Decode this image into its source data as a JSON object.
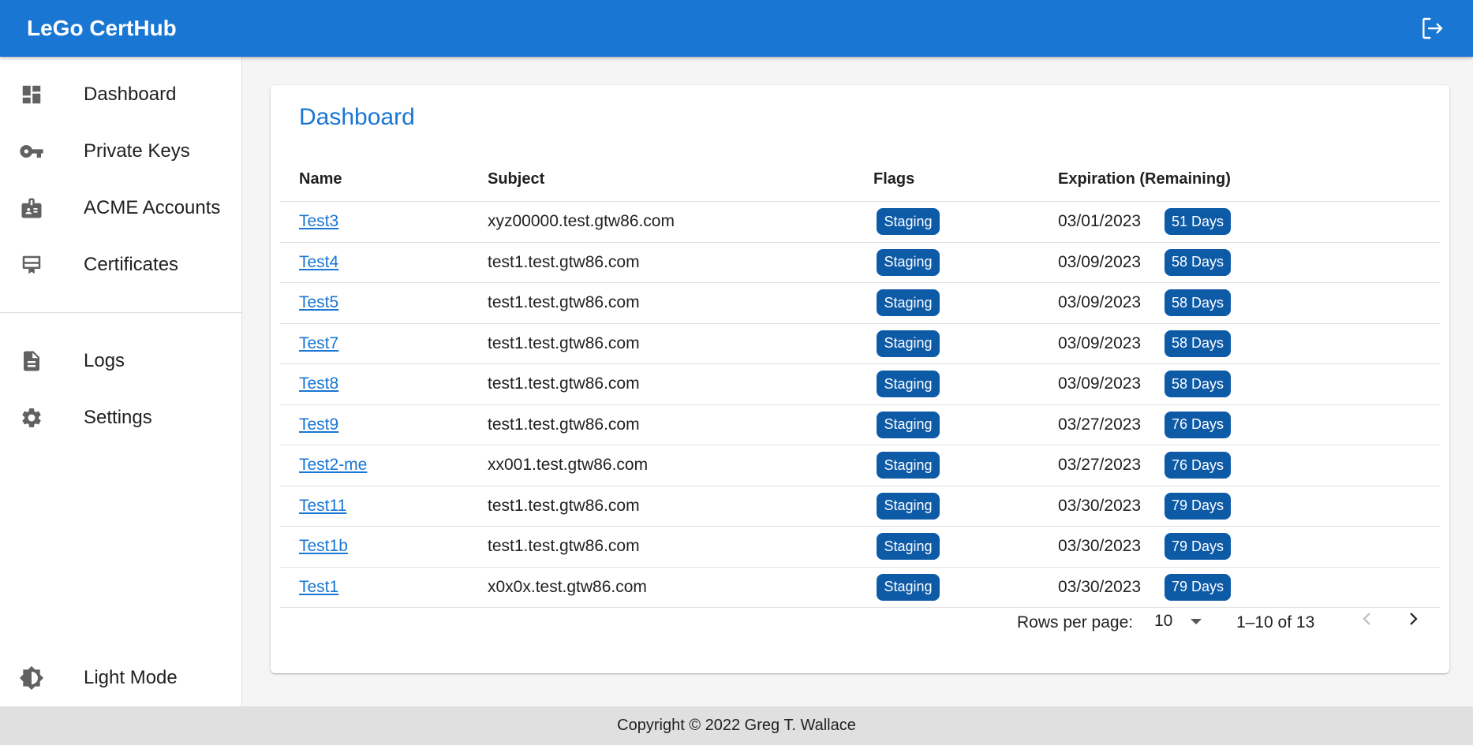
{
  "app": {
    "title": "LeGo CertHub",
    "logout_icon": "logout-icon",
    "accent": "#1976d2"
  },
  "sidebar": {
    "items": [
      {
        "label": "Dashboard",
        "icon": "dashboard-icon"
      },
      {
        "label": "Private Keys",
        "icon": "key-icon"
      },
      {
        "label": "ACME Accounts",
        "icon": "badge-icon"
      },
      {
        "label": "Certificates",
        "icon": "certificate-icon"
      },
      {
        "label": "Logs",
        "icon": "document-icon"
      },
      {
        "label": "Settings",
        "icon": "gear-icon"
      }
    ],
    "mode_toggle": {
      "label": "Light Mode",
      "icon": "brightness-icon"
    }
  },
  "main": {
    "title": "Dashboard",
    "columns": [
      "Name",
      "Subject",
      "Flags",
      "Expiration (Remaining)"
    ],
    "rows": [
      {
        "name": "Test3",
        "subject": "xyz00000.test.gtw86.com",
        "flag": "Staging",
        "expiration": "03/01/2023",
        "remaining": "51 Days"
      },
      {
        "name": "Test4",
        "subject": "test1.test.gtw86.com",
        "flag": "Staging",
        "expiration": "03/09/2023",
        "remaining": "58 Days"
      },
      {
        "name": "Test5",
        "subject": "test1.test.gtw86.com",
        "flag": "Staging",
        "expiration": "03/09/2023",
        "remaining": "58 Days"
      },
      {
        "name": "Test7",
        "subject": "test1.test.gtw86.com",
        "flag": "Staging",
        "expiration": "03/09/2023",
        "remaining": "58 Days"
      },
      {
        "name": "Test8",
        "subject": "test1.test.gtw86.com",
        "flag": "Staging",
        "expiration": "03/09/2023",
        "remaining": "58 Days"
      },
      {
        "name": "Test9",
        "subject": "test1.test.gtw86.com",
        "flag": "Staging",
        "expiration": "03/27/2023",
        "remaining": "76 Days"
      },
      {
        "name": "Test2-me",
        "subject": "xx001.test.gtw86.com",
        "flag": "Staging",
        "expiration": "03/27/2023",
        "remaining": "76 Days"
      },
      {
        "name": "Test11",
        "subject": "test1.test.gtw86.com",
        "flag": "Staging",
        "expiration": "03/30/2023",
        "remaining": "79 Days"
      },
      {
        "name": "Test1b",
        "subject": "test1.test.gtw86.com",
        "flag": "Staging",
        "expiration": "03/30/2023",
        "remaining": "79 Days"
      },
      {
        "name": "Test1",
        "subject": "x0x0x.test.gtw86.com",
        "flag": "Staging",
        "expiration": "03/30/2023",
        "remaining": "79 Days"
      }
    ],
    "pagination": {
      "rows_per_page_label": "Rows per page:",
      "rows_per_page": "10",
      "range": "1–10 of 13",
      "prev_icon": "chevron-left-icon",
      "next_icon": "chevron-right-icon"
    }
  },
  "footer": {
    "text": "Copyright © 2022 Greg T. Wallace"
  }
}
